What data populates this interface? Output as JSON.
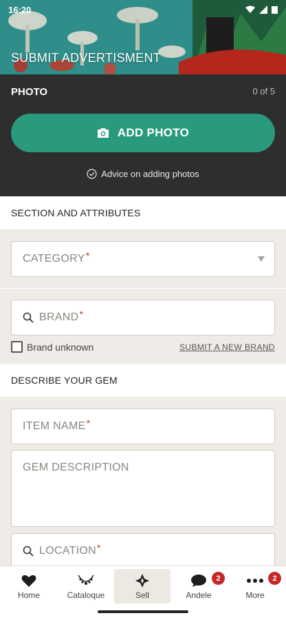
{
  "status_bar": {
    "time": "16:20"
  },
  "header": {
    "title": "SUBMIT ADVERTISMENT"
  },
  "photo": {
    "heading": "PHOTO",
    "count": "0 of 5",
    "add_button": "ADD PHOTO",
    "advice": "Advice on adding photos"
  },
  "sections": {
    "attributes": "SECTION AND ATTRIBUTES",
    "describe": "DESCRIBE YOUR GEM"
  },
  "fields": {
    "category": "CATEGORY",
    "brand": "BRAND",
    "item_name": "ITEM NAME",
    "description": "GEM DESCRIPTION",
    "location": "LOCATION",
    "required_mark": "*"
  },
  "brand_options": {
    "unknown_label": "Brand unknown",
    "submit_new": "SUBMIT A NEW BRAND"
  },
  "nav": {
    "items": [
      {
        "label": "Home",
        "icon": "heart-icon"
      },
      {
        "label": "Cataloque",
        "icon": "necklace-icon"
      },
      {
        "label": "Sell",
        "icon": "diamond-cross-icon"
      },
      {
        "label": "Andele",
        "icon": "chat-bubble-icon",
        "badge": "2"
      },
      {
        "label": "More",
        "icon": "more-dots-icon",
        "badge": "2"
      }
    ],
    "active": "Sell"
  },
  "colors": {
    "accent": "#2a9a7e",
    "dark_panel": "#2e2e2e",
    "badge": "#c62828",
    "required": "#c0392b"
  }
}
